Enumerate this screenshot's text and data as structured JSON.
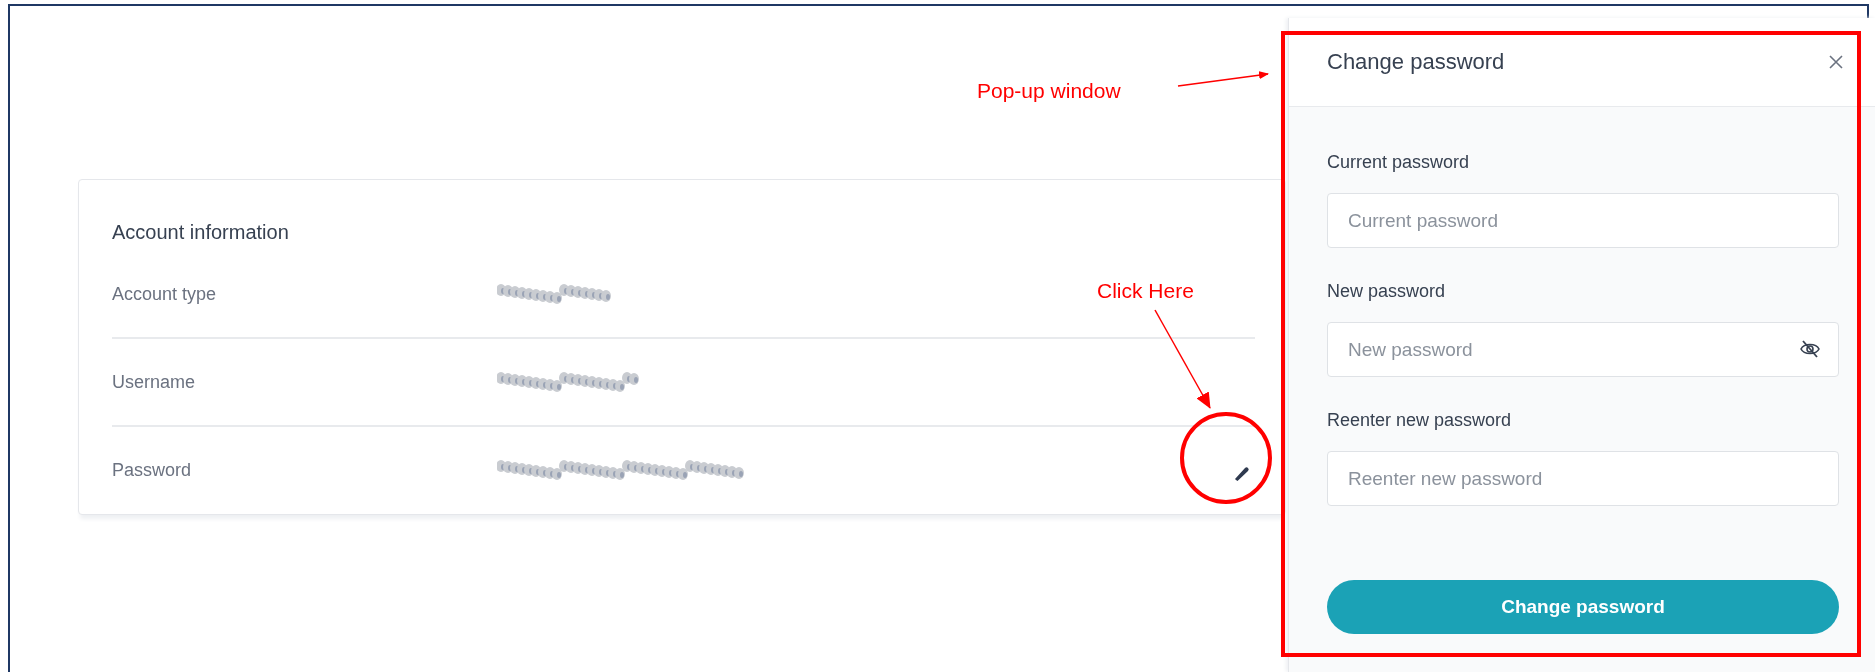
{
  "account_info": {
    "title": "Account information",
    "rows": [
      {
        "label": "Account type",
        "editable": false
      },
      {
        "label": "Username",
        "editable": false
      },
      {
        "label": "Password",
        "editable": true
      }
    ]
  },
  "dialog": {
    "title": "Change password",
    "fields": [
      {
        "label": "Current password",
        "placeholder": "Current password",
        "visibility_toggle": false
      },
      {
        "label": "New password",
        "placeholder": "New password",
        "visibility_toggle": true
      },
      {
        "label": "Reenter new password",
        "placeholder": "Reenter new password",
        "visibility_toggle": false
      }
    ],
    "submit": "Change password"
  },
  "annotations": [
    {
      "kind": "dialog",
      "text": "Pop-up window"
    },
    {
      "kind": "click",
      "text": "Click Here"
    }
  ]
}
